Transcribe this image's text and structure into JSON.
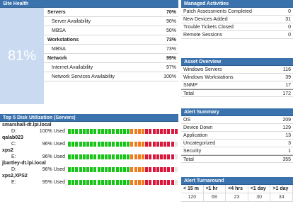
{
  "site_health": {
    "title": "Site Health",
    "score": "81%",
    "rows": [
      {
        "label": "Servers",
        "value": "70%",
        "type": "h"
      },
      {
        "label": "Server Availability",
        "value": "90%",
        "type": "s"
      },
      {
        "label": "MBSA",
        "value": "50%",
        "type": "s"
      },
      {
        "label": "Workstations",
        "value": "73%",
        "type": "h"
      },
      {
        "label": "MBSA",
        "value": "73%",
        "type": "s"
      },
      {
        "label": "Network",
        "value": "99%",
        "type": "h"
      },
      {
        "label": "Internet Availability",
        "value": "97%",
        "type": "s"
      },
      {
        "label": "Network Services Availability",
        "value": "100%",
        "type": "s"
      }
    ]
  },
  "managed_activities": {
    "title": "Managed Activities",
    "rows": [
      {
        "label": "Patch Assessments Completed",
        "value": "0"
      },
      {
        "label": "New Devices Added",
        "value": "31"
      },
      {
        "label": "Trouble Tickets Closed",
        "value": "0"
      },
      {
        "label": "Remote Sessions",
        "value": "0"
      }
    ]
  },
  "asset_overview": {
    "title": "Asset Overview",
    "rows": [
      {
        "label": "Windows Servers",
        "value": "116"
      },
      {
        "label": "Windows Workstations",
        "value": "39"
      },
      {
        "label": "SNMP",
        "value": "17"
      },
      {
        "label": "Total",
        "value": "172",
        "total": true
      }
    ]
  },
  "alert_summary": {
    "title": "Alert Summary",
    "rows": [
      {
        "label": "OS",
        "value": "209"
      },
      {
        "label": "Device Down",
        "value": "129"
      },
      {
        "label": "Application",
        "value": "13"
      },
      {
        "label": "Uncategorized",
        "value": "3"
      },
      {
        "label": "Security",
        "value": "1"
      },
      {
        "label": "Total",
        "value": "355",
        "total": true
      }
    ]
  },
  "alert_turnaround": {
    "title": "Alert Turnaround",
    "headers": [
      "< 15 m",
      "<1 hr",
      "<4 hrs",
      "<1 day",
      ">1 day"
    ],
    "values": [
      "120",
      "68",
      "23",
      "30",
      "34"
    ]
  },
  "disk": {
    "title": "Top 5 Disk Utilization (Servers)",
    "colors": {
      "green": "#18c418",
      "orange": "#f07a1e",
      "red": "#d9183c"
    },
    "hosts": [
      {
        "name": "smarshall-dt.lpi.local",
        "drive": "D:",
        "used": "100% Used",
        "pct": 1.0
      },
      {
        "name": "qalab023",
        "drive": "C:",
        "used": "96% Used",
        "pct": 0.96
      },
      {
        "name": "xps2",
        "drive": "E:",
        "used": "96% Used",
        "pct": 0.96
      },
      {
        "name": "jbartley-dt.lpi.local",
        "drive": "D:",
        "used": "96% Used",
        "pct": 0.96
      },
      {
        "name": "xps2,XPS2",
        "drive": "E:",
        "used": "95% Used",
        "pct": 0.95
      }
    ]
  }
}
